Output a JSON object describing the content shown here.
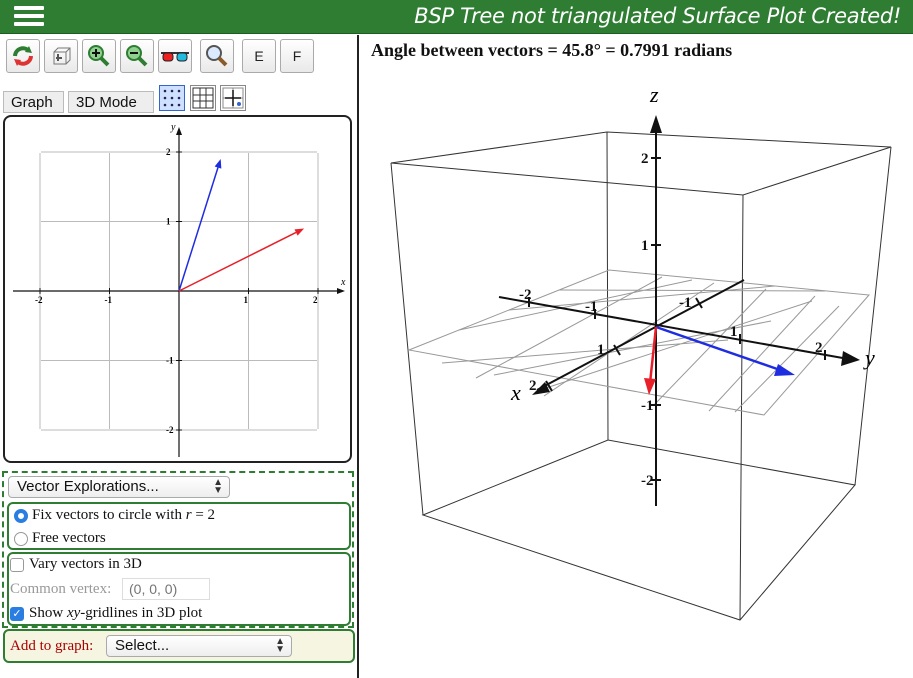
{
  "topbar": {
    "status": "BSP Tree not triangulated Surface Plot Created!"
  },
  "toolbar": {
    "e_label": "E",
    "f_label": "F"
  },
  "mode_tabs": {
    "graph": "Graph",
    "mode3d": "3D Mode"
  },
  "graph2d": {
    "x_label": "x",
    "y_label": "y",
    "x_ticks": [
      "-2",
      "-1",
      "1",
      "2"
    ],
    "y_ticks": [
      "2",
      "1",
      "-1",
      "-2"
    ],
    "vectors": [
      {
        "color": "#1f2de0",
        "x": 0.6,
        "y": 1.9
      },
      {
        "color": "#e8202a",
        "x": 1.8,
        "y": 0.9
      }
    ]
  },
  "explorations": {
    "select_value": "Vector Explorations...",
    "fix_circle": {
      "prefix": "Fix vectors to circle with ",
      "var": "r",
      "suffix": " = 2",
      "checked": true
    },
    "free_vectors": {
      "label": "Free vectors",
      "checked": false
    },
    "vary3d": {
      "label": "Vary vectors in 3D",
      "checked": false
    },
    "vertex": {
      "label": "Common vertex:",
      "placeholder": "(0, 0, 0)"
    },
    "gridlines": {
      "prefix": "Show ",
      "var": "xy",
      "suffix": "-gridlines in 3D plot",
      "checked": true
    }
  },
  "add_graph": {
    "label": "Add to graph:",
    "select_value": "Select..."
  },
  "plot3d": {
    "angle_text": "Angle between vectors  =  45.8°  =  0.7991 radians",
    "axis_labels": {
      "x": "x",
      "y": "y",
      "z": "z"
    },
    "z_ticks": [
      "2",
      "1",
      "-1",
      "-2"
    ],
    "y_ticks": [
      "-2",
      "-1",
      "1",
      "2"
    ],
    "x_ticks": [
      "-1",
      "1",
      "2"
    ],
    "vector_colors": [
      "#1f2de0",
      "#e8202a"
    ]
  }
}
